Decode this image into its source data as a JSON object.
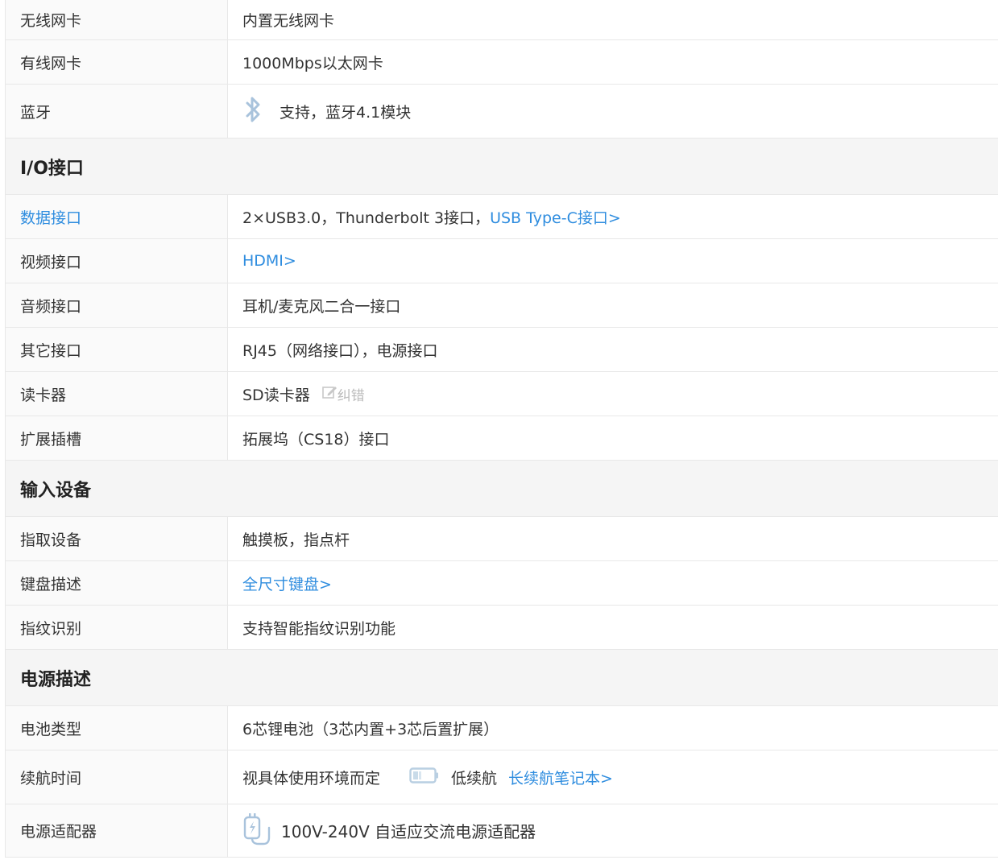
{
  "rows": {
    "wireless": {
      "key": "无线网卡",
      "value": "内置无线网卡"
    },
    "wired": {
      "key": "有线网卡",
      "value": "1000Mbps以太网卡"
    },
    "bluetooth": {
      "key": "蓝牙",
      "value": "支持，蓝牙4.1模块",
      "icon": "bluetooth-icon"
    }
  },
  "io": {
    "title": "I/O接口",
    "data_port": {
      "key": "数据接口",
      "value": "2×USB3.0，Thunderbolt 3接口，",
      "link": "USB Type-C接口>"
    },
    "video_port": {
      "key": "视频接口",
      "link": "HDMI>"
    },
    "audio_port": {
      "key": "音频接口",
      "value": "耳机/麦克风二合一接口"
    },
    "other_port": {
      "key": "其它接口",
      "value": "RJ45（网络接口），电源接口"
    },
    "card_reader": {
      "key": "读卡器",
      "value": "SD读卡器",
      "correction": "纠错",
      "icon": "edit-icon"
    },
    "expansion": {
      "key": "扩展插槽",
      "value": "拓展坞（CS18）接口"
    }
  },
  "input": {
    "title": "输入设备",
    "pointing": {
      "key": "指取设备",
      "value": "触摸板，指点杆"
    },
    "keyboard": {
      "key": "键盘描述",
      "link": "全尺寸键盘>"
    },
    "fingerprint": {
      "key": "指纹识别",
      "value": "支持智能指纹识别功能"
    }
  },
  "power": {
    "title": "电源描述",
    "battery": {
      "key": "电池类型",
      "value": "6芯锂电池（3芯内置+3芯后置扩展）"
    },
    "endurance": {
      "key": "续航时间",
      "value": "视具体使用环境而定",
      "tag": "低续航",
      "link": "长续航笔记本>",
      "icon": "battery-low-icon"
    },
    "adapter": {
      "key": "电源适配器",
      "value": "100V-240V 自适应交流电源适配器",
      "icon": "power-adapter-icon"
    }
  },
  "colors": {
    "link": "#2f8ddf",
    "label_bg": "#fafafa",
    "section_bg": "#f5f5f5",
    "border": "#e8e8e8"
  }
}
